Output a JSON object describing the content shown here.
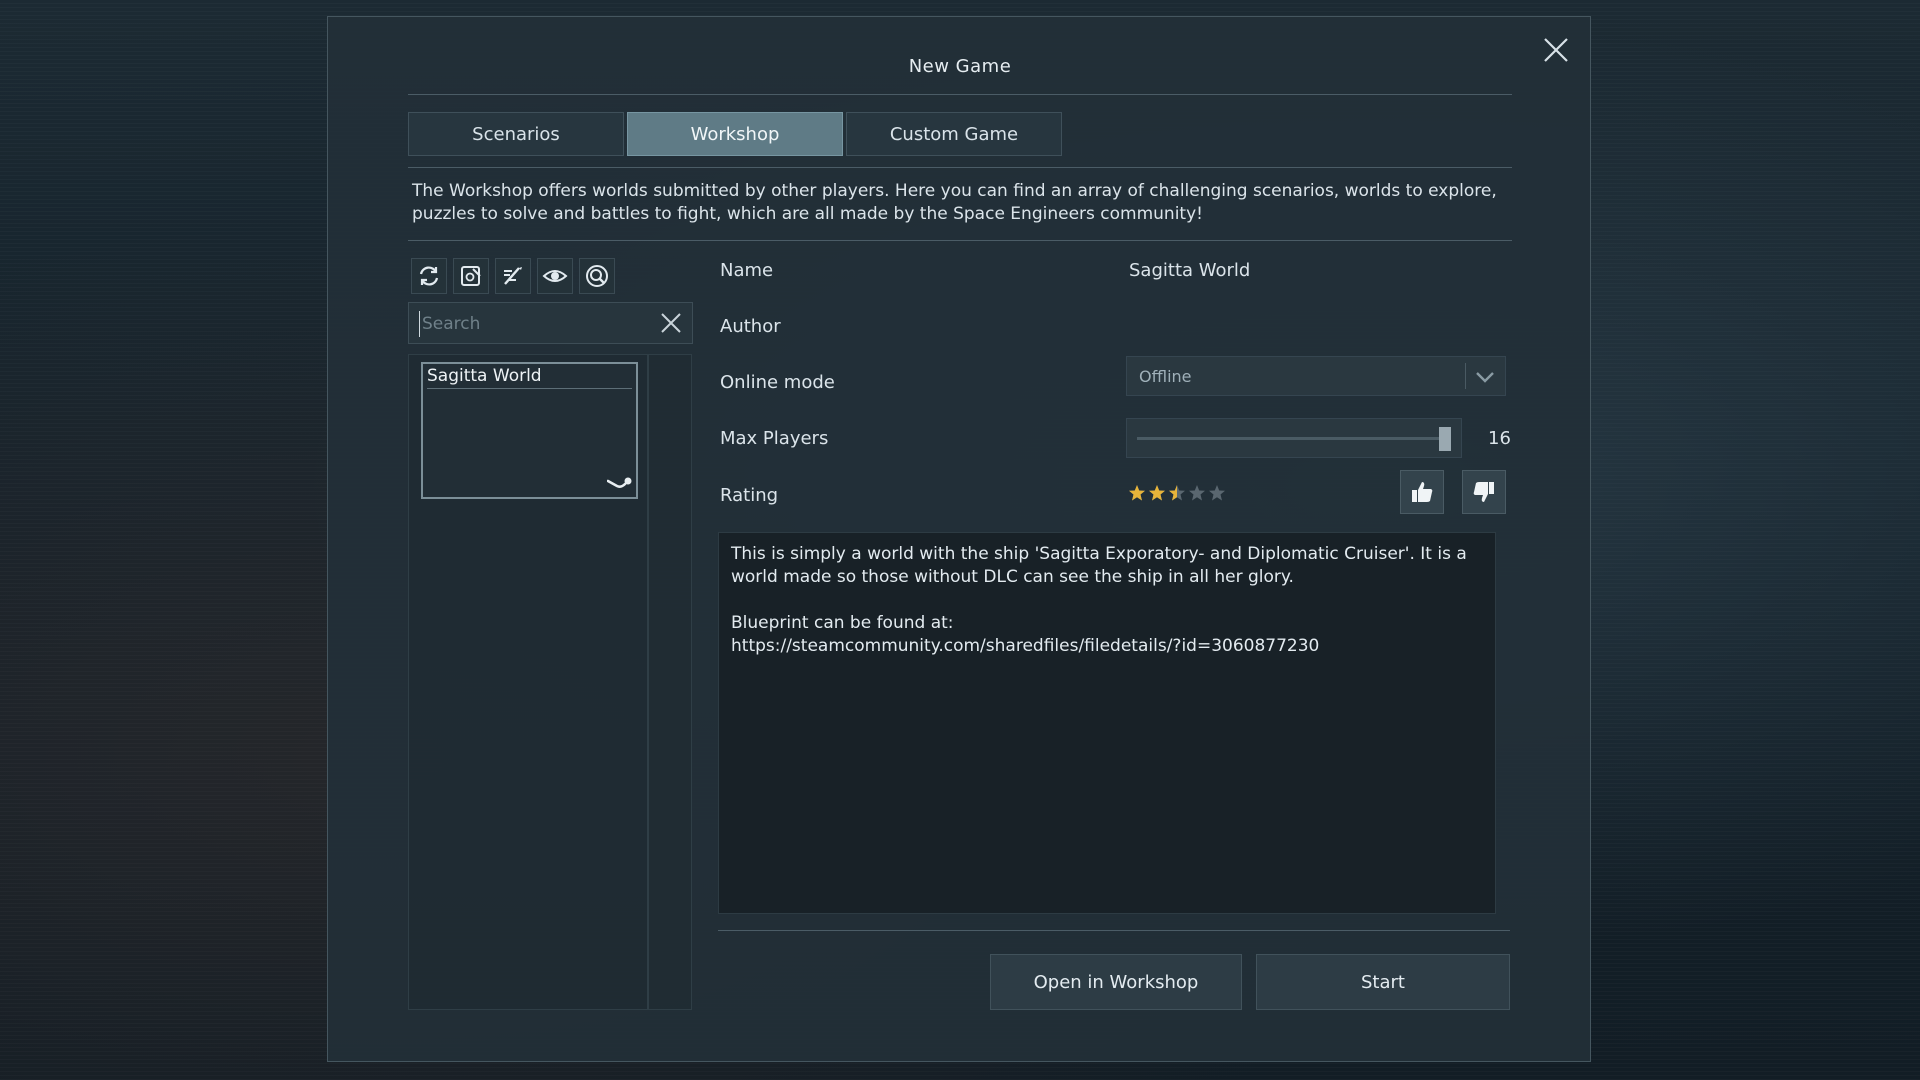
{
  "dialog": {
    "title": "New Game"
  },
  "tabs": [
    {
      "label": "Scenarios",
      "active": false
    },
    {
      "label": "Workshop",
      "active": true
    },
    {
      "label": "Custom Game",
      "active": false
    }
  ],
  "intro_text": "The Workshop offers worlds submitted by other players. Here you can find an array of challenging scenarios, worlds to explore, puzzles to solve and battles to fight, which are all made by the Space Engineers community!",
  "toolbar": {
    "icons": [
      "refresh-icon",
      "edit-settings-icon",
      "quick-edit-icon",
      "eye-icon",
      "magnifier-icon"
    ]
  },
  "search": {
    "placeholder": "Search",
    "value": ""
  },
  "world_list": [
    {
      "name": "Sagitta World",
      "source_icon": "steam-icon"
    }
  ],
  "details": {
    "name_label": "Name",
    "name_value": "Sagitta World",
    "author_label": "Author",
    "author_value": "",
    "online_mode_label": "Online mode",
    "online_mode_value": "Offline",
    "max_players_label": "Max Players",
    "max_players_value": "16",
    "max_players_fraction": 0.98,
    "rating_label": "Rating",
    "rating_stars": 2.5,
    "rating_max": 5,
    "description": "This is simply a world with the ship 'Sagitta Exporatory- and Diplomatic Cruiser'. It is a world made so those without DLC can see the ship in all her glory.\n\nBlueprint can be found at:\nhttps://steamcommunity.com/sharedfiles/filedetails/?id=3060877230"
  },
  "buttons": {
    "open_workshop": "Open in Workshop",
    "start": "Start"
  },
  "colors": {
    "star_filled": "#e7b43a",
    "star_empty": "#5a6770",
    "active_tab": "#5f7b86"
  }
}
